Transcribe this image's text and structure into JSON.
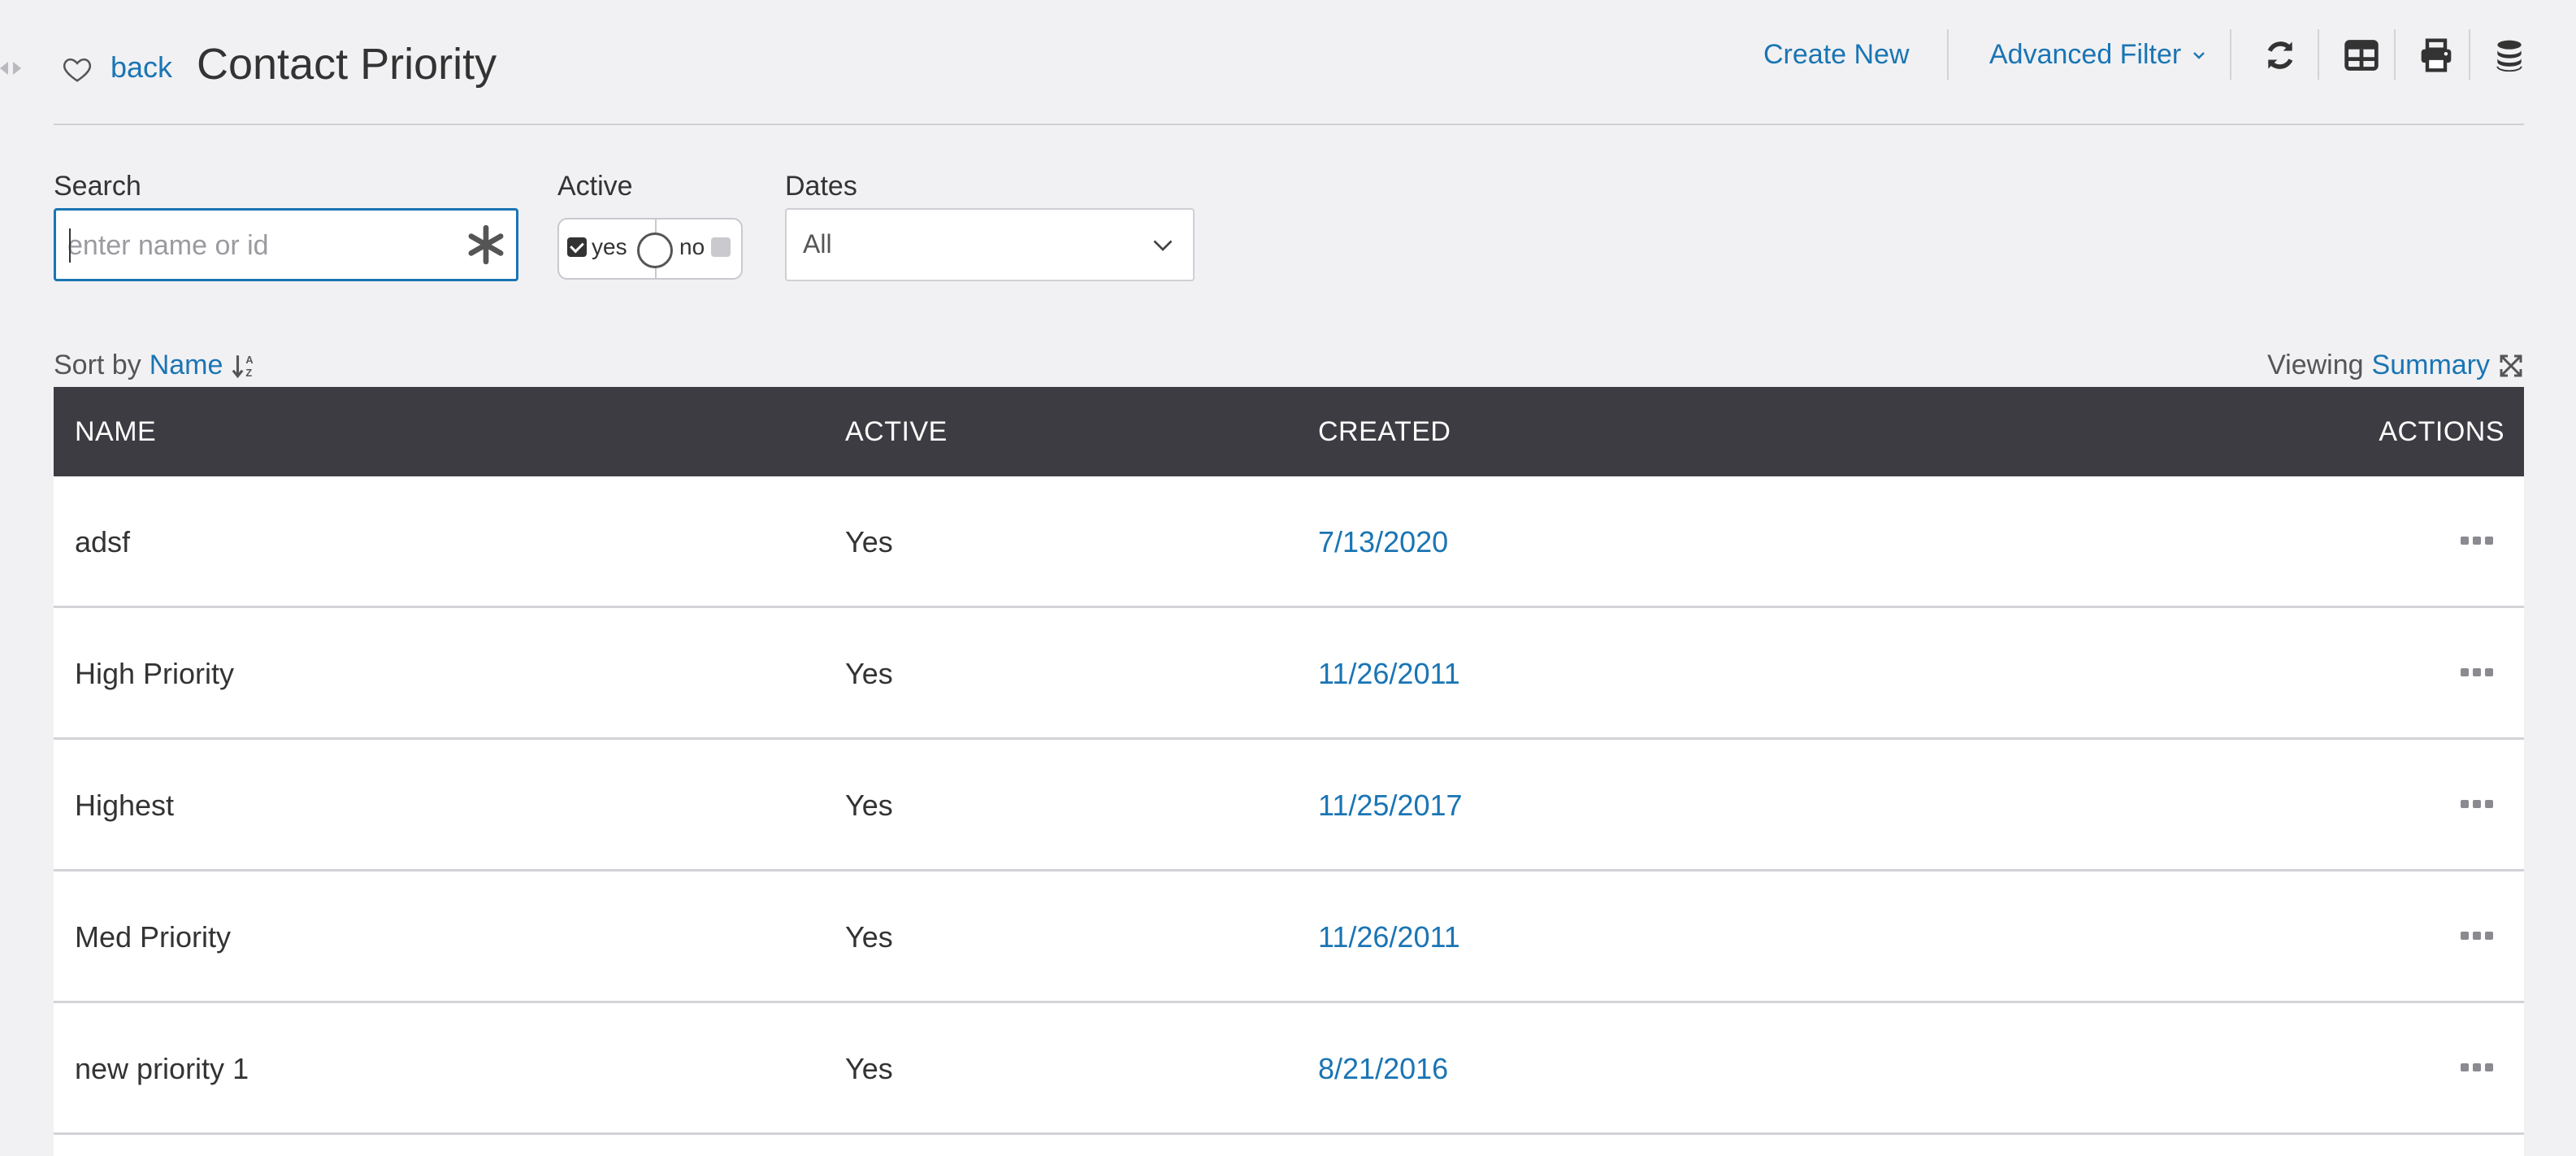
{
  "header": {
    "back_label": "back",
    "title": "Contact Priority",
    "create_new_label": "Create New",
    "advanced_filter_label": "Advanced Filter",
    "icons": [
      "nav-arrows-icon",
      "heart-icon",
      "chevron-down-icon",
      "refresh-icon",
      "table-icon",
      "print-icon",
      "database-icon"
    ]
  },
  "filters": {
    "search_label": "Search",
    "search_placeholder": "enter name or id",
    "search_value": "",
    "active_label": "Active",
    "active_yes": "yes",
    "active_no": "no",
    "dates_label": "Dates",
    "dates_value": "All"
  },
  "sort": {
    "prefix": "Sort by",
    "field": "Name"
  },
  "viewing": {
    "prefix": "Viewing",
    "mode": "Summary"
  },
  "table": {
    "columns": [
      "NAME",
      "ACTIVE",
      "CREATED",
      "ACTIONS"
    ],
    "rows": [
      {
        "name": "adsf",
        "active": "Yes",
        "created": "7/13/2020"
      },
      {
        "name": "High Priority",
        "active": "Yes",
        "created": "11/26/2011"
      },
      {
        "name": "Highest",
        "active": "Yes",
        "created": "11/25/2017"
      },
      {
        "name": "Med Priority",
        "active": "Yes",
        "created": "11/26/2011"
      },
      {
        "name": "new priority 1",
        "active": "Yes",
        "created": "8/21/2016"
      }
    ]
  },
  "colors": {
    "link": "#1a75b4",
    "header_bg": "#3c3c42",
    "page_bg": "#f1f1f3"
  }
}
